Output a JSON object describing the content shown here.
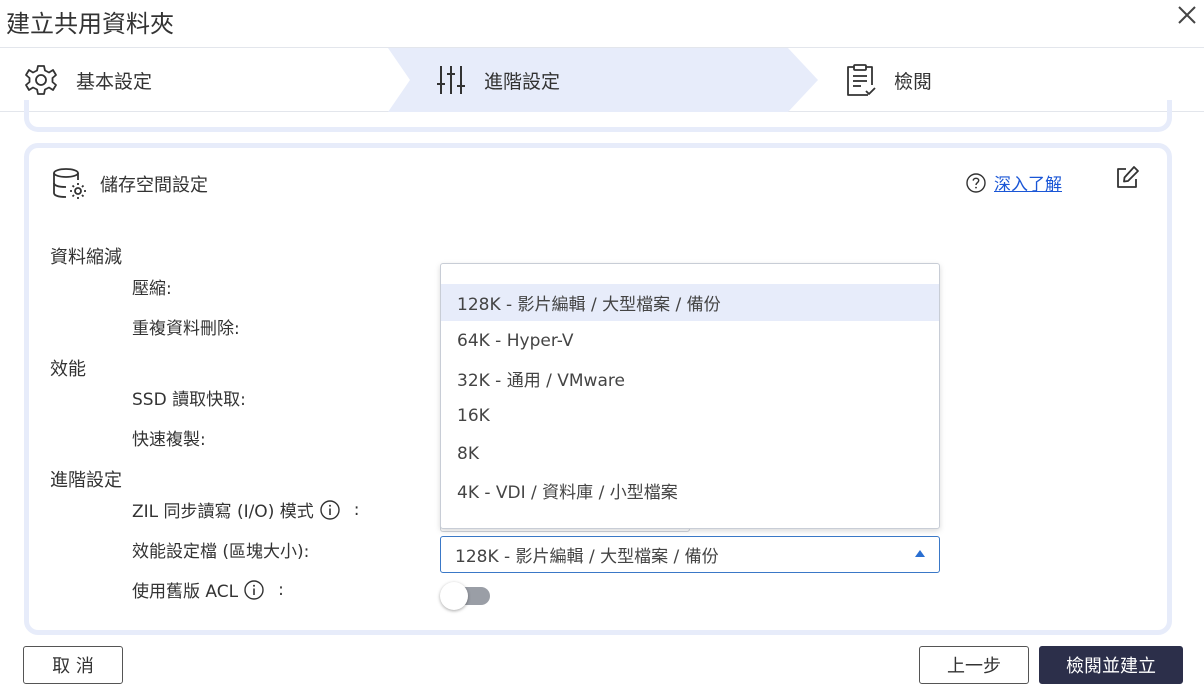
{
  "window": {
    "title": "建立共用資料夾"
  },
  "steps": [
    {
      "label": "基本設定",
      "icon": "gear-icon"
    },
    {
      "label": "進階設定",
      "icon": "sliders-icon",
      "active": true
    },
    {
      "label": "檢閱",
      "icon": "clipboard-check-icon"
    }
  ],
  "card": {
    "title": "儲存空間設定",
    "learn_more": "深入了解"
  },
  "sections": {
    "data_reduction": "資料縮減",
    "performance": "效能",
    "advanced": "進階設定"
  },
  "fields": {
    "compression": "壓縮:",
    "dedup": "重複資料刪除:",
    "ssd_cache": "SSD 讀取快取:",
    "fast_clone": "快速複製:",
    "zil_prefix": "ZIL 同步讀寫 (I/O) 模式",
    "zil_suffix": ":",
    "profile": "效能設定檔 (區塊大小):",
    "legacy_acl_prefix": "使用舊版 ACL",
    "legacy_acl_suffix": ":"
  },
  "profile_select": {
    "value": "128K - 影片編輯 / 大型檔案 / 備份",
    "options": [
      "128K - 影片編輯 / 大型檔案 / 備份",
      "64K - Hyper-V",
      "32K - 通用 / VMware",
      "16K",
      "8K",
      "4K - VDI / 資料庫 / 小型檔案"
    ]
  },
  "legacy_acl_toggle": {
    "on": false
  },
  "buttons": {
    "cancel": "取 消",
    "prev": "上一步",
    "review_create": "檢閱並建立"
  },
  "colors": {
    "active_step_bg": "#e7ecfa",
    "primary_button": "#2c2f4a",
    "link": "#1a56d6",
    "select_border": "#3a78c7"
  }
}
